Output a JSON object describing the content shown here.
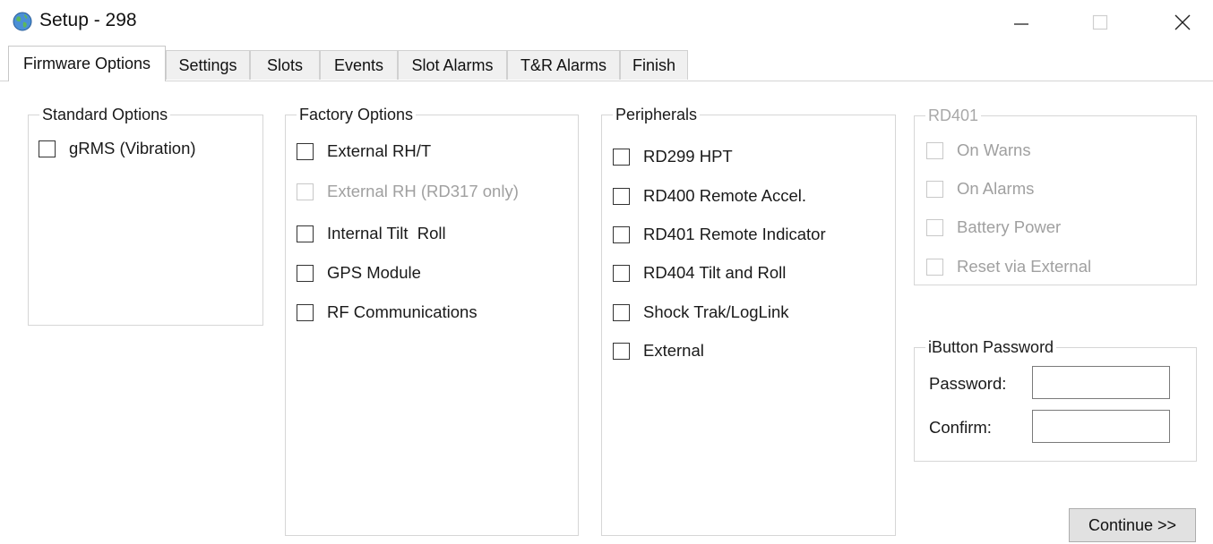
{
  "window": {
    "title": "Setup - 298",
    "controls": {
      "minimize": "minimize-icon",
      "maximize": "maximize-icon",
      "close": "close-icon"
    }
  },
  "tabs": [
    {
      "label": "Firmware Options",
      "active": true
    },
    {
      "label": "Settings",
      "active": false
    },
    {
      "label": "Slots",
      "active": false
    },
    {
      "label": "Events",
      "active": false
    },
    {
      "label": "Slot Alarms",
      "active": false
    },
    {
      "label": "T&R Alarms",
      "active": false
    },
    {
      "label": "Finish",
      "active": false
    }
  ],
  "standard_options": {
    "legend": "Standard Options",
    "items": [
      {
        "label": "gRMS (Vibration)",
        "checked": false,
        "enabled": true
      }
    ]
  },
  "factory_options": {
    "legend": "Factory Options",
    "items": [
      {
        "label": "External RH/T",
        "checked": false,
        "enabled": true
      },
      {
        "label": "External RH (RD317 only)",
        "checked": false,
        "enabled": false
      },
      {
        "label": "Internal Tilt  Roll",
        "checked": false,
        "enabled": true
      },
      {
        "label": "GPS Module",
        "checked": false,
        "enabled": true
      },
      {
        "label": "RF Communications",
        "checked": false,
        "enabled": true
      }
    ]
  },
  "peripherals": {
    "legend": "Peripherals",
    "items": [
      {
        "label": "RD299 HPT",
        "checked": false,
        "enabled": true
      },
      {
        "label": "RD400 Remote Accel.",
        "checked": false,
        "enabled": true
      },
      {
        "label": "RD401 Remote Indicator",
        "checked": false,
        "enabled": true
      },
      {
        "label": "RD404 Tilt and Roll",
        "checked": false,
        "enabled": true
      },
      {
        "label": "Shock Trak/LogLink",
        "checked": false,
        "enabled": true
      },
      {
        "label": "External",
        "checked": false,
        "enabled": true
      }
    ]
  },
  "rd401": {
    "legend": "RD401",
    "enabled": false,
    "items": [
      {
        "label": "On Warns",
        "checked": false,
        "enabled": false
      },
      {
        "label": "On Alarms",
        "checked": false,
        "enabled": false
      },
      {
        "label": "Battery Power",
        "checked": false,
        "enabled": false
      },
      {
        "label": "Reset via External",
        "checked": false,
        "enabled": false
      }
    ]
  },
  "ibutton_password": {
    "legend": "iButton Password",
    "password_label": "Password:",
    "password_value": "",
    "confirm_label": "Confirm:",
    "confirm_value": ""
  },
  "continue_button": {
    "label": "Continue >>"
  }
}
